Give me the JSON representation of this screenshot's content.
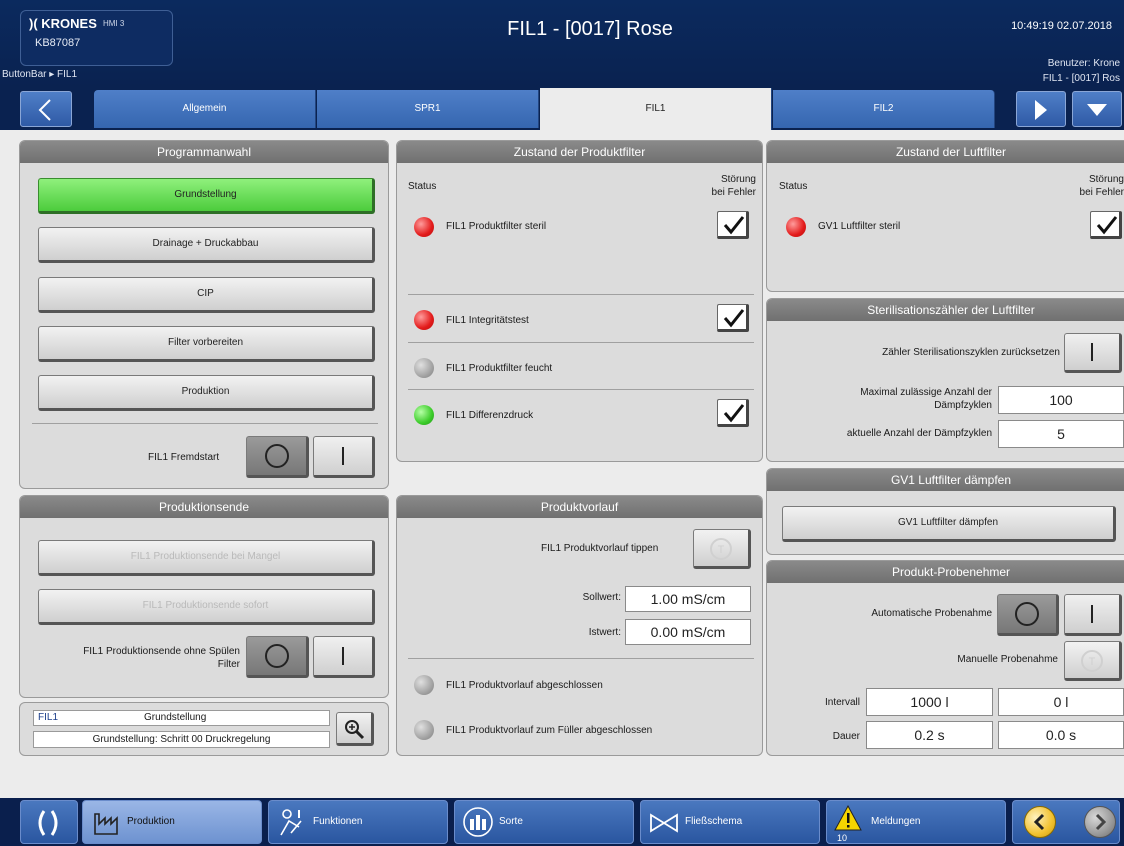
{
  "header": {
    "brand": "KRONES",
    "hmi": "HMI 3",
    "machine_id": "KB87087",
    "title": "FIL1 - [0017]  Rose",
    "datetime": "10:49:19 02.07.2018",
    "user": "Benutzer: Krone",
    "context": "FIL1 - [0017]  Ros",
    "breadcrumb": "ButtonBar ▸ FIL1"
  },
  "tabs": [
    {
      "label": "Allgemein"
    },
    {
      "label": "SPR1"
    },
    {
      "label": "FIL1"
    },
    {
      "label": "FIL2"
    }
  ],
  "programmanwahl": {
    "title": "Programmanwahl",
    "buttons": [
      "Grundstellung",
      "Drainage + Druckabbau",
      "CIP",
      "Filter vorbereiten",
      "Produktion"
    ],
    "fremdstart_label": "FIL1 Fremdstart"
  },
  "produktionsende": {
    "title": "Produktionsende",
    "btn1": "FIL1 Produktionsende bei Mangel",
    "btn2": "FIL1 Produktionsende sofort",
    "ohne_label_1": "FIL1 Produktionsende ohne Spülen",
    "ohne_label_2": "Filter"
  },
  "status_box": {
    "tag": "FIL1",
    "state": "Grundstellung",
    "step": "Grundstellung: Schritt 00 Druckregelung"
  },
  "produktfilter": {
    "title": "Zustand der Produktfilter",
    "status_label": "Status",
    "stoerung_1": "Störung",
    "stoerung_2": "bei Fehler",
    "items": [
      {
        "label": "FIL1 Produktfilter steril",
        "led": "red",
        "checked": true
      },
      {
        "label": "FIL1 Integritätstest",
        "led": "red",
        "checked": true
      },
      {
        "label": "FIL1 Produktfilter feucht",
        "led": "grey",
        "checked": false
      },
      {
        "label": "FIL1 Differenzdruck",
        "led": "green",
        "checked": true
      }
    ]
  },
  "produktvorlauf": {
    "title": "Produktvorlauf",
    "tippen_label": "FIL1 Produktvorlauf tippen",
    "sollwert_label": "Sollwert:",
    "sollwert": "1.00 mS/cm",
    "istwert_label": "Istwert:",
    "istwert": "0.00 mS/cm",
    "done1": "FIL1 Produktvorlauf abgeschlossen",
    "done2": "FIL1 Produktvorlauf zum Füller abgeschlossen"
  },
  "luftfilter": {
    "title": "Zustand der Luftfilter",
    "status_label": "Status",
    "stoerung_1": "Störung",
    "stoerung_2": "bei Fehler",
    "item": "GV1 Luftfilter steril"
  },
  "sterilzaehler": {
    "title": "Sterilisationszähler der Luftfilter",
    "reset_label": "Zähler Sterilisationszyklen zurücksetzen",
    "max_label_1": "Maximal zulässige Anzahl der",
    "max_label_2": "Dämpfzyklen",
    "max_value": "100",
    "akt_label": "aktuelle Anzahl der Dämpfzyklen",
    "akt_value": "5"
  },
  "daempfen": {
    "title": "GV1 Luftfilter dämpfen",
    "button": "GV1 Luftfilter dämpfen"
  },
  "probenehmer": {
    "title": "Produkt-Probenehmer",
    "auto_label": "Automatische Probenahme",
    "manual_label": "Manuelle Probenahme",
    "intervall_label": "Intervall",
    "intervall_set": "1000 l",
    "intervall_act": "0 l",
    "dauer_label": "Dauer",
    "dauer_set": "0.2 s",
    "dauer_act": "0.0 s"
  },
  "taskbar": {
    "produktion": "Produktion",
    "funktionen": "Funktionen",
    "sorte": "Sorte",
    "fliessschema": "Fließschema",
    "meldungen": "Meldungen",
    "meldungen_count": "10"
  }
}
